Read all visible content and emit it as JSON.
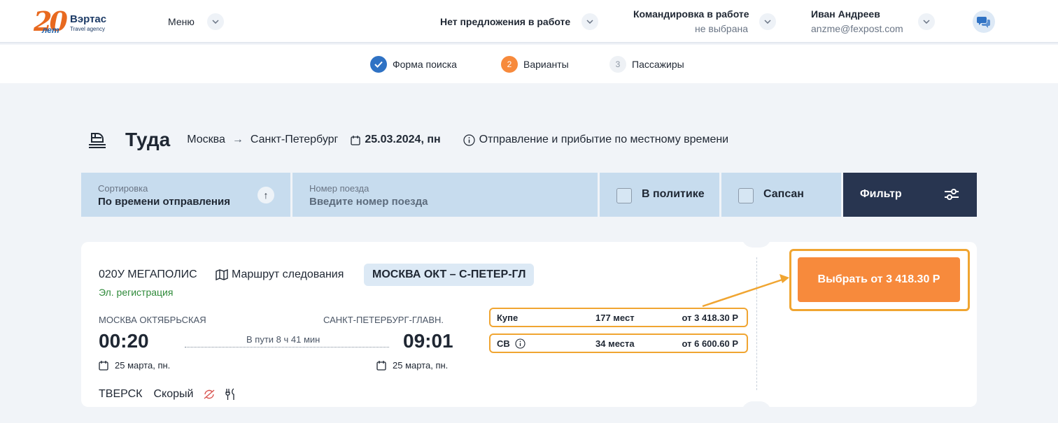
{
  "header": {
    "logo": {
      "number": "20",
      "years": "лет",
      "name": "Вэртас",
      "subtitle": "Travel agency"
    },
    "menu_label": "Меню",
    "offer_label": "Нет предложения в работе",
    "trip_label": "Командировка в работе",
    "trip_sub": "не выбрана",
    "user_name": "Иван Андреев",
    "user_email": "anzme@fexpost.com"
  },
  "steps": [
    {
      "label": "Форма поиска",
      "status": "done",
      "marker": "✓"
    },
    {
      "label": "Варианты",
      "status": "active",
      "marker": "2"
    },
    {
      "label": "Пассажиры",
      "status": "pending",
      "marker": "3"
    }
  ],
  "search_header": {
    "title": "Туда",
    "from": "Москва",
    "to": "Санкт-Петербург",
    "date": "25.03.2024, пн",
    "note": "Отправление и прибытие по местному времени"
  },
  "filters": {
    "sort_label": "Сортировка",
    "sort_value": "По времени отправления",
    "train_label": "Номер поезда",
    "train_placeholder": "Введите номер поезда",
    "policy_label": "В политике",
    "sapsan_label": "Сапсан",
    "filter_button": "Фильтр"
  },
  "train": {
    "number": "020У МЕГАПОЛИС",
    "route_link": "Маршрут следования",
    "route_badge": "МОСКВА ОКТ – С-ПЕТЕР-ГЛ",
    "e_registration": "Эл. регистрация",
    "dep_station": "МОСКВА ОКТЯБРЬСКАЯ",
    "arr_station": "САНКТ-ПЕТЕРБУРГ-ГЛАВН.",
    "dep_time": "00:20",
    "arr_time": "09:01",
    "duration": "В пути 8 ч 41 мин",
    "dep_date": "25 марта, пн.",
    "arr_date": "25 марта, пн.",
    "brand": "ТВЕРСК",
    "category": "Скорый",
    "fares": [
      {
        "class": "Купе",
        "seats": "177 мест",
        "price": "от 3 418.30 Р"
      },
      {
        "class": "СВ",
        "seats": "34 места",
        "price": "от 6 600.60 Р"
      }
    ],
    "select_button": "Выбрать от 3 418.30 Р"
  },
  "colors": {
    "accent_orange": "#f78a3c",
    "highlight": "#f0a531",
    "step_done": "#2f72c4",
    "filter_dark": "#283550",
    "filter_bg": "#c7dcee",
    "e_reg_green": "#2f8a3a"
  },
  "icons": [
    "chevron-down-icon",
    "chat-icon",
    "check-icon",
    "train-icon",
    "arrow-right-icon",
    "calendar-icon",
    "info-icon",
    "arrow-up-icon",
    "filter-sliders-icon",
    "map-icon",
    "no-refund-icon",
    "fork-knife-icon"
  ]
}
